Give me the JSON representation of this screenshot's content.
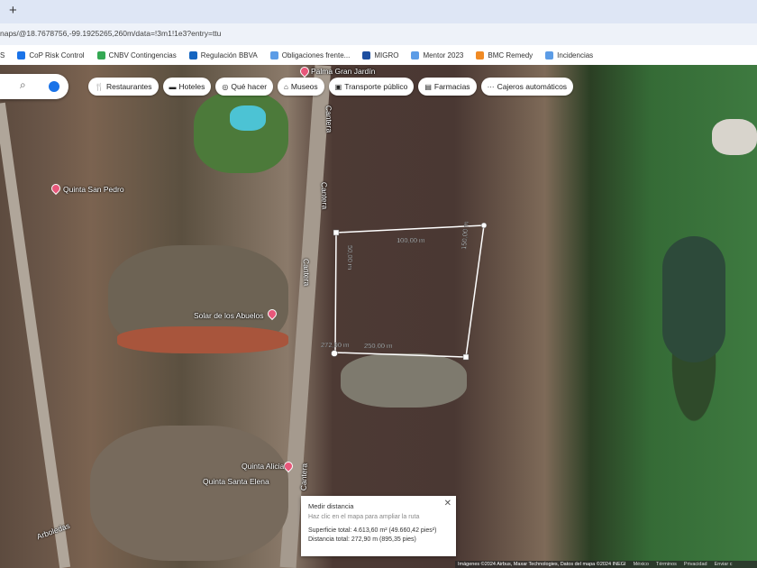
{
  "browser": {
    "new_tab": "+",
    "url": "naps/@18.7678756,-99.1925265,260m/data=!3m1!1e3?entry=ttu",
    "bookmarks": [
      {
        "label": "S",
        "color": "#888"
      },
      {
        "label": "CoP Risk Control",
        "color": "#1a73e8"
      },
      {
        "label": "CNBV Contingencias",
        "color": "#34a853"
      },
      {
        "label": "Regulación BBVA",
        "color": "#1565c0"
      },
      {
        "label": "Obligaciones frente...",
        "color": "#5c9ce6"
      },
      {
        "label": "MIGRO",
        "color": "#1e4fa0"
      },
      {
        "label": "Mentor 2023",
        "color": "#5c9ce6"
      },
      {
        "label": "BMC Remedy",
        "color": "#f08a24"
      },
      {
        "label": "Incidencias",
        "color": "#5c9ce6"
      }
    ]
  },
  "chips": [
    {
      "icon": "fork-knife-icon",
      "glyph": "🍴",
      "label": "Restaurantes"
    },
    {
      "icon": "bed-icon",
      "glyph": "▬",
      "label": "Hoteles"
    },
    {
      "icon": "camera-icon",
      "glyph": "◎",
      "label": "Qué hacer"
    },
    {
      "icon": "museum-icon",
      "glyph": "⌂",
      "label": "Museos"
    },
    {
      "icon": "bus-icon",
      "glyph": "▣",
      "label": "Transporte público"
    },
    {
      "icon": "pharmacy-icon",
      "glyph": "▤",
      "label": "Farmacias"
    },
    {
      "icon": "more-icon",
      "glyph": "···",
      "label": "Cajeros automáticos"
    }
  ],
  "map_labels": {
    "palma": "Palma Gran Jardín",
    "quinta1": "Quinta San Pedro",
    "solar": "Solar de los Abuelos",
    "alicia": "Quinta Alicia",
    "santa": "Quinta Santa Elena",
    "cantera1": "Cantera",
    "cantera2": "Cantera",
    "cantera3": "Cantera",
    "cantera4": "Cantera",
    "arboledas": "Arboledas"
  },
  "measure": {
    "seg_top": "100,00 m",
    "seg_left": "50,00 m",
    "seg_right": "150,00 m",
    "seg_bottom": "250,00 m",
    "seg_total": "272,90 m"
  },
  "popup": {
    "title": "Medir distancia",
    "hint": "Haz clic en el mapa para ampliar la ruta",
    "area": "Superficie total: 4.613,60 m² (49.660,42 pies²)",
    "distance": "Distancia total: 272,90 m (895,35 pies)",
    "close": "✕"
  },
  "attribution": {
    "imagery": "Imágenes ©2024 Airbus, Maxar Technologies, Datos del mapa ©2024 INEGI",
    "country": "México",
    "terms": "Términos",
    "privacy": "Privacidad",
    "feedback": "Enviar c"
  }
}
